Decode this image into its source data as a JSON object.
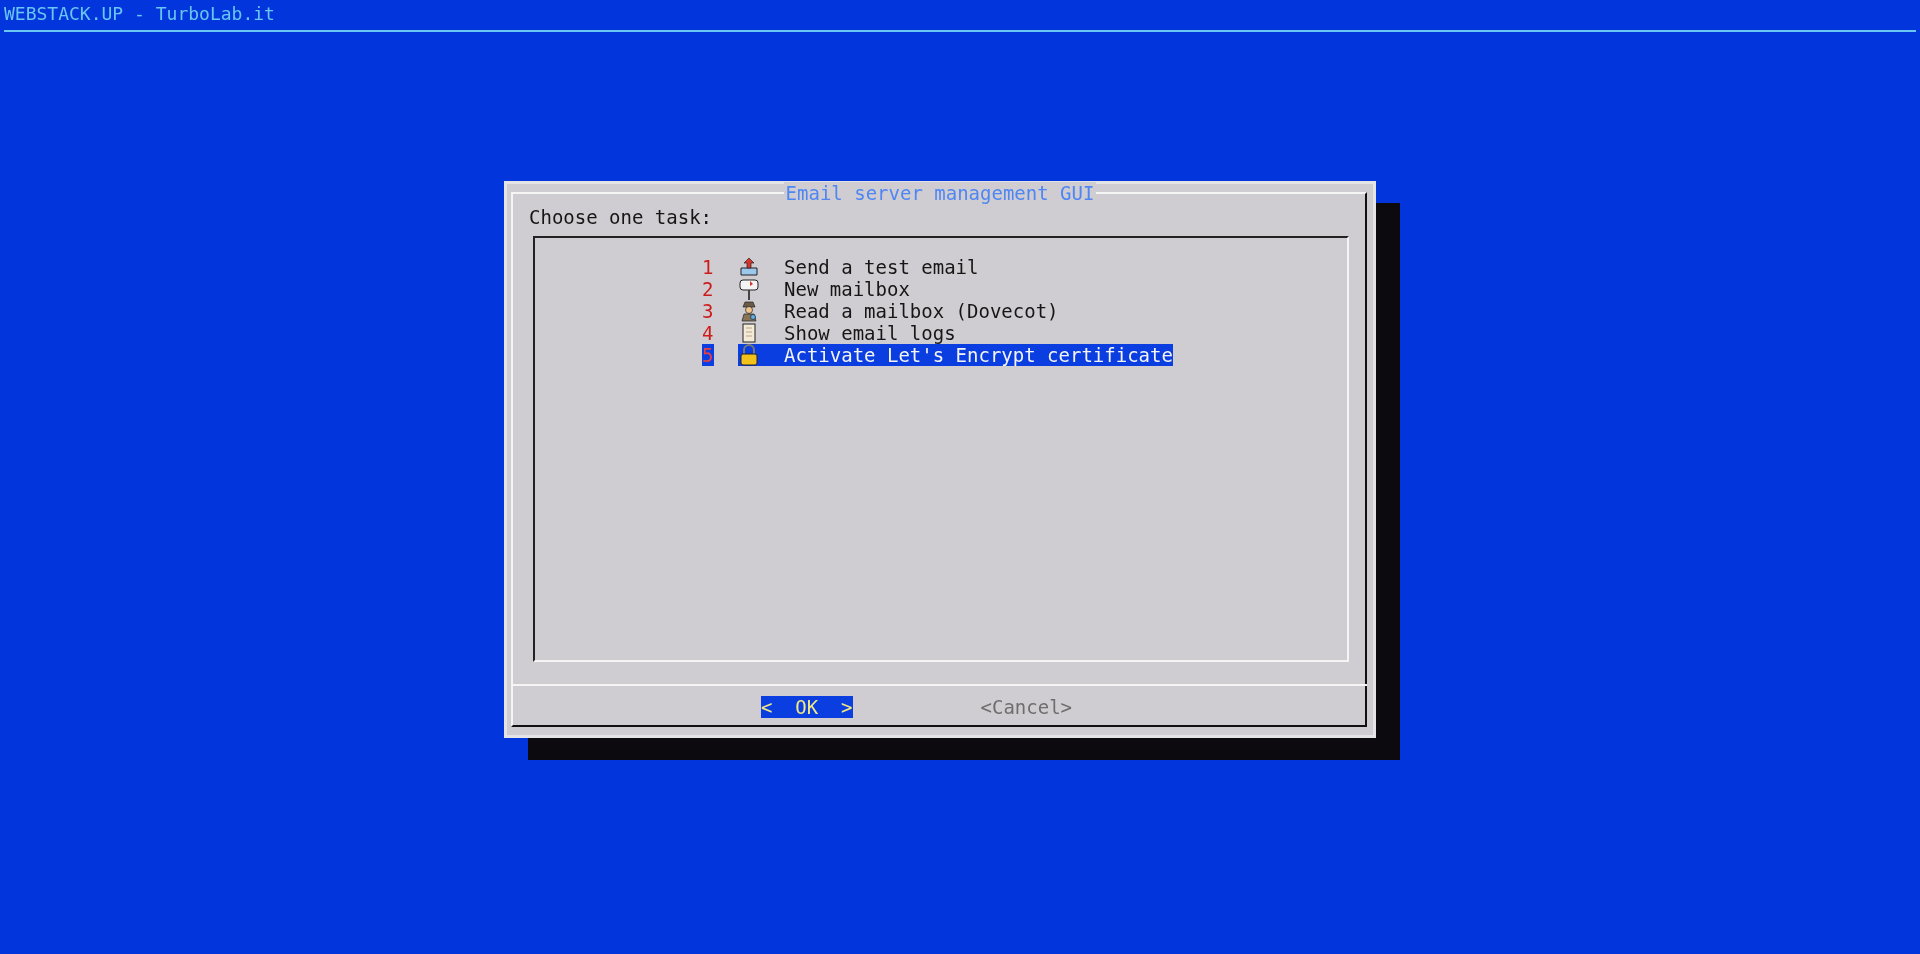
{
  "backtitle": "WEBSTACK.UP - TurboLab.it",
  "dialog": {
    "title": "Email server management GUI",
    "prompt": "Choose one task:",
    "items": [
      {
        "number": "1",
        "kind": "outbox",
        "label": "Send a test email",
        "selected": false
      },
      {
        "number": "2",
        "kind": "mailbox",
        "label": "New mailbox",
        "selected": false
      },
      {
        "number": "3",
        "kind": "detective",
        "label": "Read a mailbox (Dovecot)",
        "selected": false
      },
      {
        "number": "4",
        "kind": "scroll",
        "label": "Show email logs",
        "selected": false
      },
      {
        "number": "5",
        "kind": "lock",
        "label": "Activate Let's Encrypt certificate",
        "selected": true
      }
    ],
    "buttons": [
      {
        "label": "<  OK  >",
        "selected": true
      },
      {
        "label": "<Cancel>",
        "selected": false
      }
    ]
  }
}
